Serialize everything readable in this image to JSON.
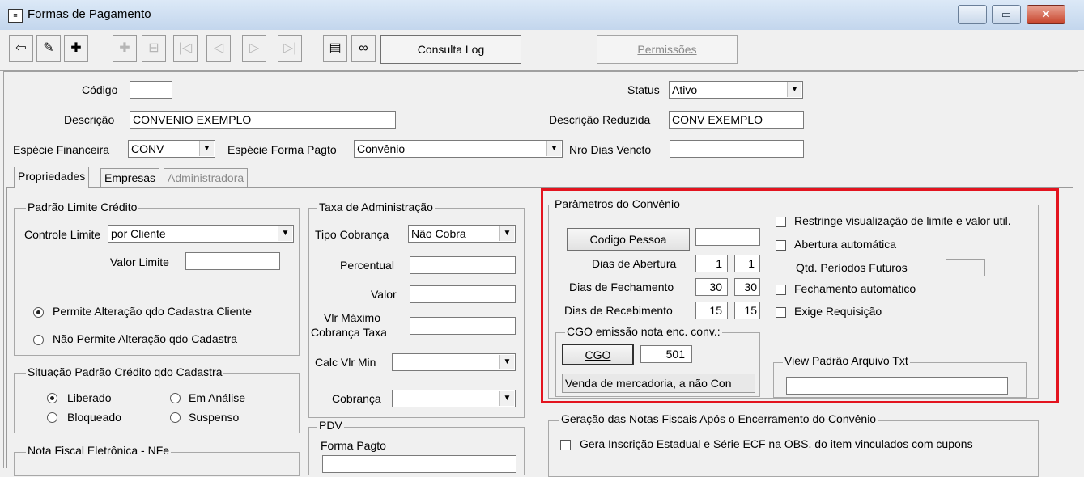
{
  "window": {
    "title": "Formas de Pagamento",
    "minimize": "‒",
    "maximize": "▭",
    "close": "✕"
  },
  "toolbar": {
    "consulta_log": "Consulta Log",
    "permissoes": "Permissões"
  },
  "header": {
    "codigo_label": "Código",
    "codigo_value": "",
    "status_label": "Status",
    "status_value": "Ativo",
    "descricao_label": "Descrição",
    "descricao_value": "CONVENIO EXEMPLO",
    "descricao_reduzida_label": "Descrição Reduzida",
    "descricao_reduzida_value": "CONV EXEMPLO",
    "especie_financeira_label": "Espécie Financeira",
    "especie_financeira_value": "CONV",
    "especie_forma_pagto_label": "Espécie Forma Pagto",
    "especie_forma_pagto_value": "Convênio",
    "nro_dias_vencto_label": "Nro Dias Vencto",
    "nro_dias_vencto_value": ""
  },
  "tabs": [
    {
      "label": "Propriedades"
    },
    {
      "label": "Empresas"
    },
    {
      "label": "Administradora"
    }
  ],
  "padrao_limite": {
    "title": "Padrão Limite Crédito",
    "controle_label": "Controle Limite",
    "controle_value": "por Cliente",
    "valor_label": "Valor Limite",
    "valor_value": "",
    "radio1": "Permite Alteração qdo Cadastra Cliente",
    "radio2": "Não Permite Alteração qdo Cadastra"
  },
  "situacao": {
    "title": "Situação Padrão Crédito qdo Cadastra",
    "liberado": "Liberado",
    "em_analise": "Em Análise",
    "bloqueado": "Bloqueado",
    "suspenso": "Suspenso"
  },
  "nfe": {
    "title": "Nota Fiscal Eletrônica - NFe"
  },
  "taxa": {
    "title": "Taxa de Administração",
    "tipo_label": "Tipo Cobrança",
    "tipo_value": "Não Cobra",
    "percentual_label": "Percentual",
    "valor_label": "Valor",
    "vlr_max_label1": "Vlr Máximo",
    "vlr_max_label2": "Cobrança Taxa",
    "calc_label": "Calc Vlr Min",
    "cobranca_label": "Cobrança"
  },
  "pdv": {
    "title": "PDV",
    "forma_label": "Forma Pagto"
  },
  "convenio": {
    "title": "Parâmetros do Convênio",
    "codigo_pessoa": "Codigo Pessoa",
    "dias_abertura_label": "Dias de Abertura",
    "dias_abertura_1": "1",
    "dias_abertura_2": "1",
    "dias_fechamento_label": "Dias de Fechamento",
    "dias_fechamento_1": "30",
    "dias_fechamento_2": "30",
    "dias_recebimento_label": "Dias de Recebimento",
    "dias_recebimento_1": "15",
    "dias_recebimento_2": "15",
    "restringe": "Restringe visualização de limite e valor util.",
    "abertura_auto": "Abertura automática",
    "qtd_periodos": "Qtd. Períodos Futuros",
    "fechamento_auto": "Fechamento automático",
    "exige_req": "Exige Requisição",
    "cgo_title": "CGO emissão nota enc. conv.:",
    "cgo_button": "CGO",
    "cgo_value": "501",
    "cgo_desc": "Venda de mercadoria, a não Con",
    "view_title": "View Padrão Arquivo Txt",
    "view_value": ""
  },
  "geracao": {
    "title": "Geração das Notas Fiscais Após o Encerramento do Convênio",
    "gera_inscricao": "Gera Inscrição Estadual e Série ECF na OBS. do item vinculados com cupons"
  },
  "colors": {
    "highlight": "#e3141f"
  }
}
